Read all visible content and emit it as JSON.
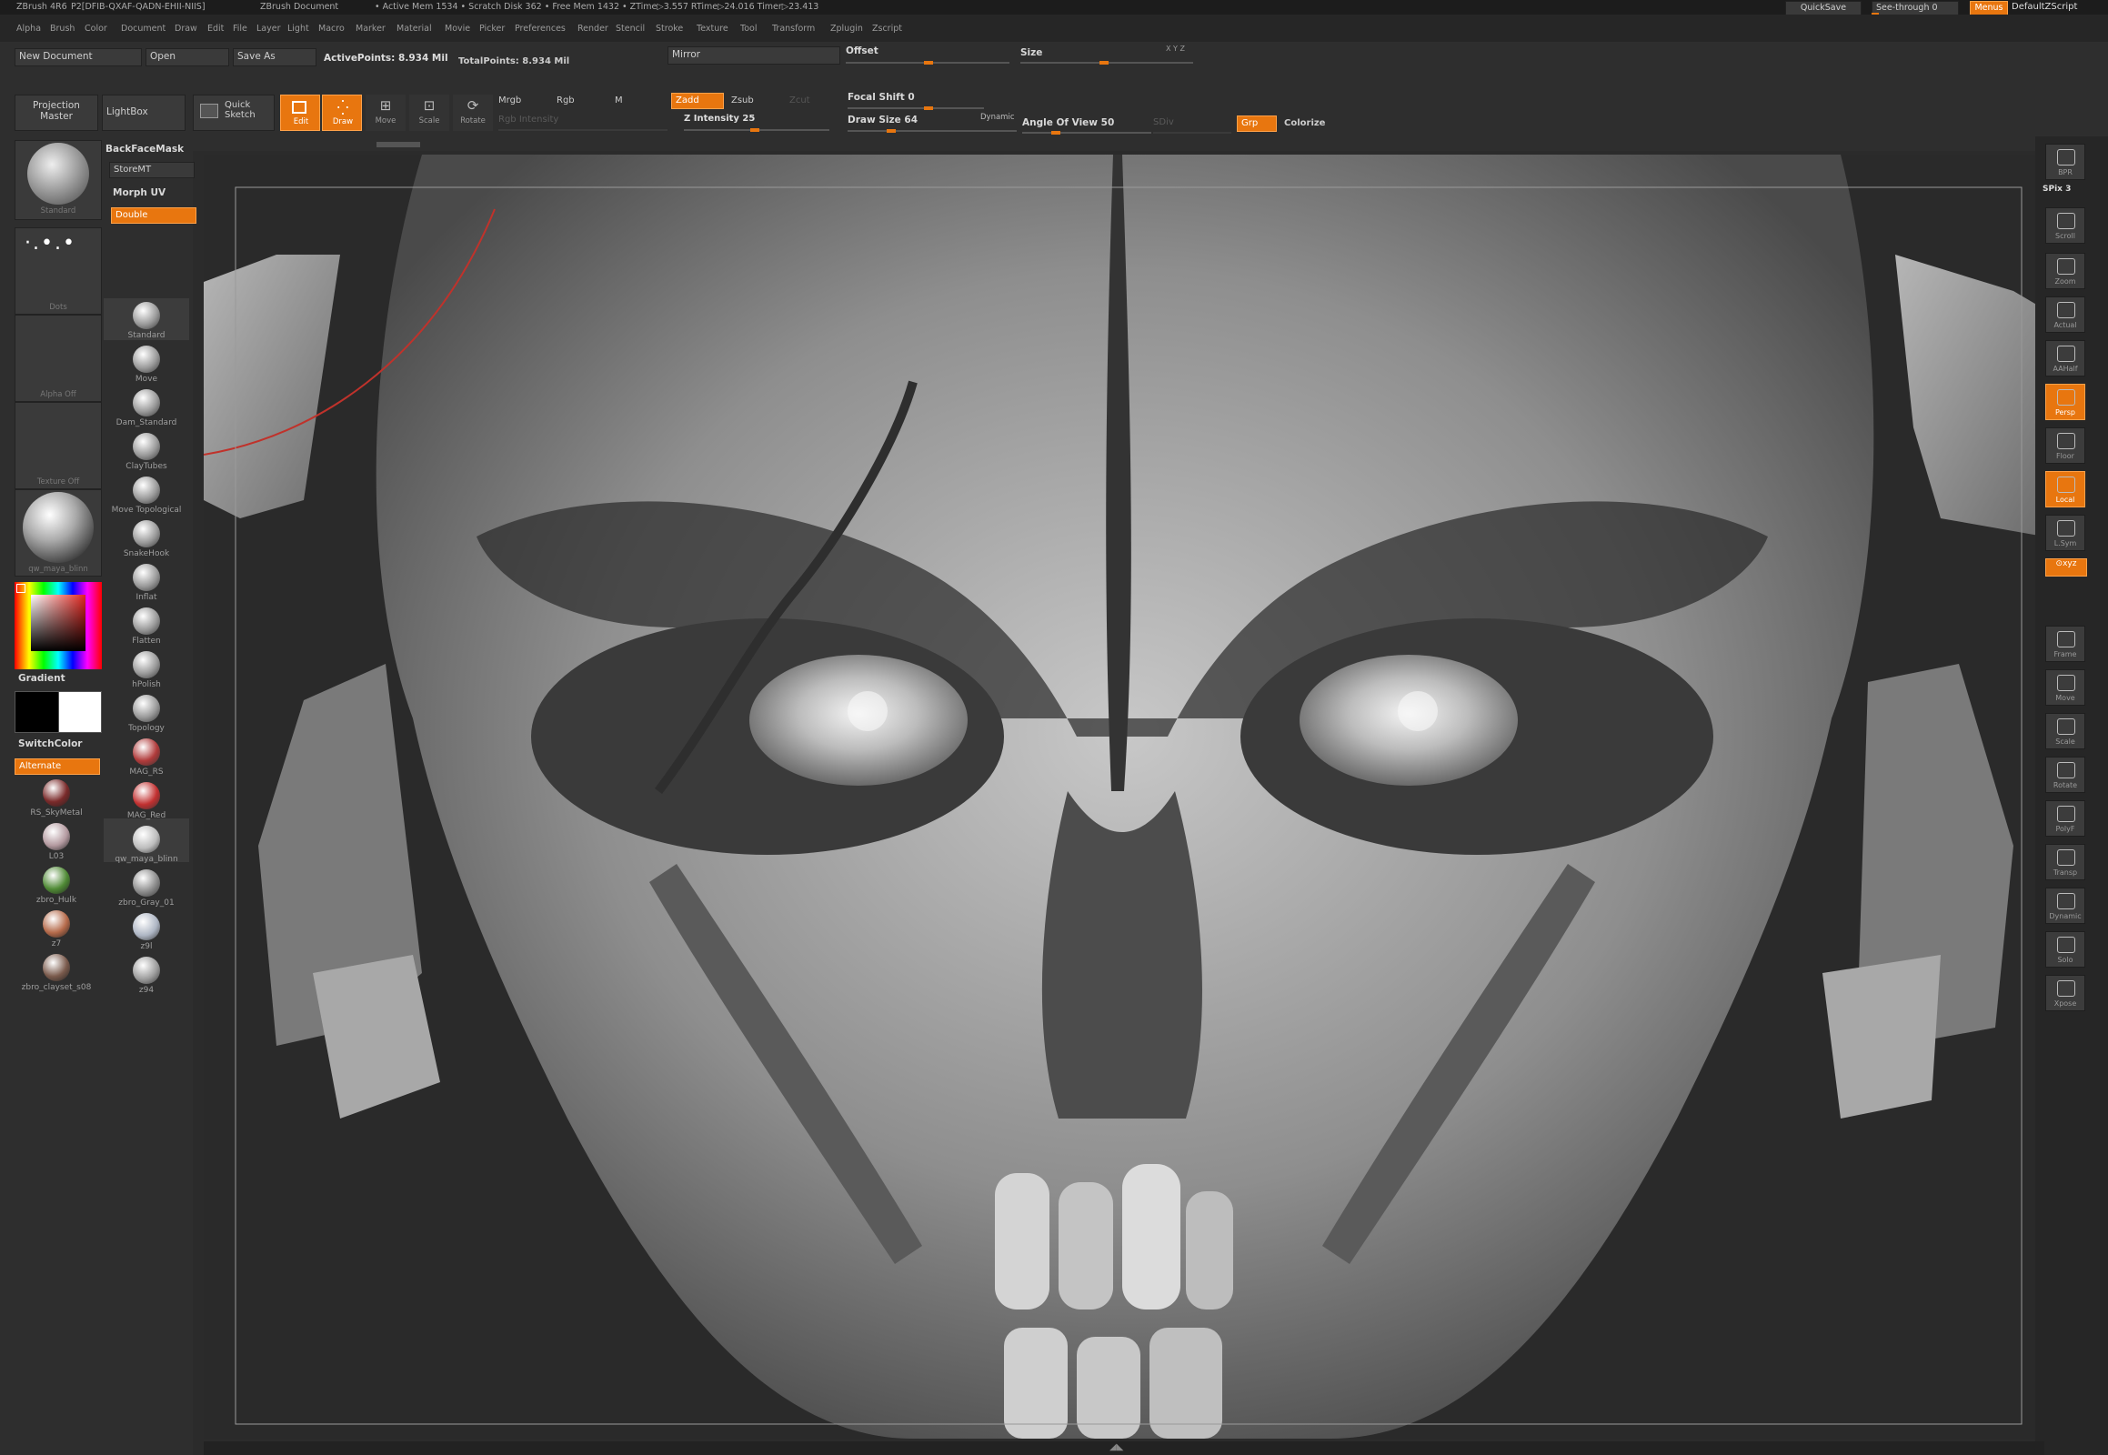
{
  "titlebar": {
    "app": "ZBrush 4R6",
    "serial": "P2[DFIB-QXAF-QADN-EHII-NIIS]",
    "document": "ZBrush Document",
    "stats": "• Active Mem 1534 • Scratch Disk 362 • Free Mem 1432 • ZTime▷3.557 RTime▷24.016 Timer▷23.413",
    "quicksave": "QuickSave",
    "seethrough": "See-through  0",
    "menus": "Menus",
    "defaultzscript": "DefaultZScript"
  },
  "menubar": {
    "items": [
      "Alpha",
      "Brush",
      "Color",
      "Document",
      "Draw",
      "Edit",
      "File",
      "Layer",
      "Light",
      "Macro",
      "Marker",
      "Material",
      "Movie",
      "Picker",
      "Preferences",
      "Render",
      "Stencil",
      "Stroke",
      "Texture",
      "Tool",
      "Transform",
      "Zplugin",
      "Zscript"
    ]
  },
  "docbar": {
    "new_document": "New Document",
    "open": "Open",
    "save_as": "Save As",
    "active_points": "ActivePoints: 8.934 Mil",
    "total_points": "TotalPoints: 8.934 Mil",
    "mirror": "Mirror",
    "offset": "Offset",
    "size": "Size",
    "xyz": "X Y Z"
  },
  "toolbar": {
    "projection_master": "Projection Master",
    "lightbox": "LightBox",
    "quick_sketch": "Quick Sketch",
    "edit": "Edit",
    "draw": "Draw",
    "move": "Move",
    "scale": "Scale",
    "rotate": "Rotate",
    "mrgb": "Mrgb",
    "rgb": "Rgb",
    "m": "M",
    "zadd": "Zadd",
    "zsub": "Zsub",
    "zcut": "Zcut",
    "rgb_intensity": "Rgb Intensity",
    "z_intensity": "Z Intensity 25",
    "z_intensity_value": 25,
    "focal_shift": "Focal Shift 0",
    "draw_size": "Draw Size 64",
    "draw_size_value": 64,
    "dynamic": "Dynamic",
    "angle_of_view": "Angle Of View 50",
    "angle_of_view_value": 50,
    "sdiv": "SDiv",
    "grp": "Grp",
    "colorize": "Colorize"
  },
  "left": {
    "standard": "Standard",
    "dots": "Dots",
    "alpha_off": "Alpha  Off",
    "texture_off": "Texture  Off",
    "material": "qw_maya_blinn",
    "backfacemask": "BackFaceMask",
    "storemt": "StoreMT",
    "morph_uv": "Morph UV",
    "double": "Double",
    "gradient": "Gradient",
    "switchcolor": "SwitchColor",
    "alternate": "Alternate",
    "brushes": [
      {
        "label": "Standard",
        "color": "#9a9a9a"
      },
      {
        "label": "Move",
        "color": "#9a9a9a"
      },
      {
        "label": "Dam_Standard",
        "color": "#9a9a9a"
      },
      {
        "label": "ClayTubes",
        "color": "#9a9a9a"
      },
      {
        "label": "Move Topological",
        "color": "#9a9a9a"
      },
      {
        "label": "SnakeHook",
        "color": "#9a9a9a"
      },
      {
        "label": "Inflat",
        "color": "#9a9a9a"
      },
      {
        "label": "Flatten",
        "color": "#9a9a9a"
      },
      {
        "label": "hPolish",
        "color": "#9a9a9a"
      },
      {
        "label": "Topology",
        "color": "#9a9a9a"
      },
      {
        "label": "MAG_RS",
        "color": "#b03a3a"
      },
      {
        "label": "MAG_Red",
        "color": "#c23030"
      },
      {
        "label": "qw_maya_blinn",
        "color": "#bdbdbd"
      },
      {
        "label": "zbro_Gray_01",
        "color": "#8c8c8c"
      },
      {
        "label": "z9l",
        "color": "#aeb6c4"
      },
      {
        "label": "z94",
        "color": "#9d9d9d"
      }
    ],
    "materials": [
      {
        "label": "RS_SkyMetal",
        "color": "#7a2a2a"
      },
      {
        "label": "L03",
        "color": "#b49aa0"
      },
      {
        "label": "zbro_Hulk",
        "color": "#4f8a35"
      },
      {
        "label": "z7",
        "color": "#b56a4a"
      },
      {
        "label": "zbro_clayset_s08",
        "color": "#7a5a4c"
      }
    ]
  },
  "right": {
    "bpr": "BPR",
    "spix": "SPix 3",
    "scroll": "Scroll",
    "zoom": "Zoom",
    "actual": "Actual",
    "aahalf": "AAHalf",
    "persp": "Persp",
    "floor": "Floor",
    "local": "Local",
    "lsym": "L.Sym",
    "xyz": "⊙xyz",
    "frame": "Frame",
    "move": "Move",
    "scale": "Scale",
    "rotate": "Rotate",
    "polyf": "PolyF",
    "transp": "Transp",
    "dynamic": "Dynamic",
    "solo": "Solo",
    "xpose": "Xpose"
  },
  "colors": {
    "accent": "#e8760f",
    "panel": "#2e2e2e",
    "canvas": "#2a2a2a"
  }
}
